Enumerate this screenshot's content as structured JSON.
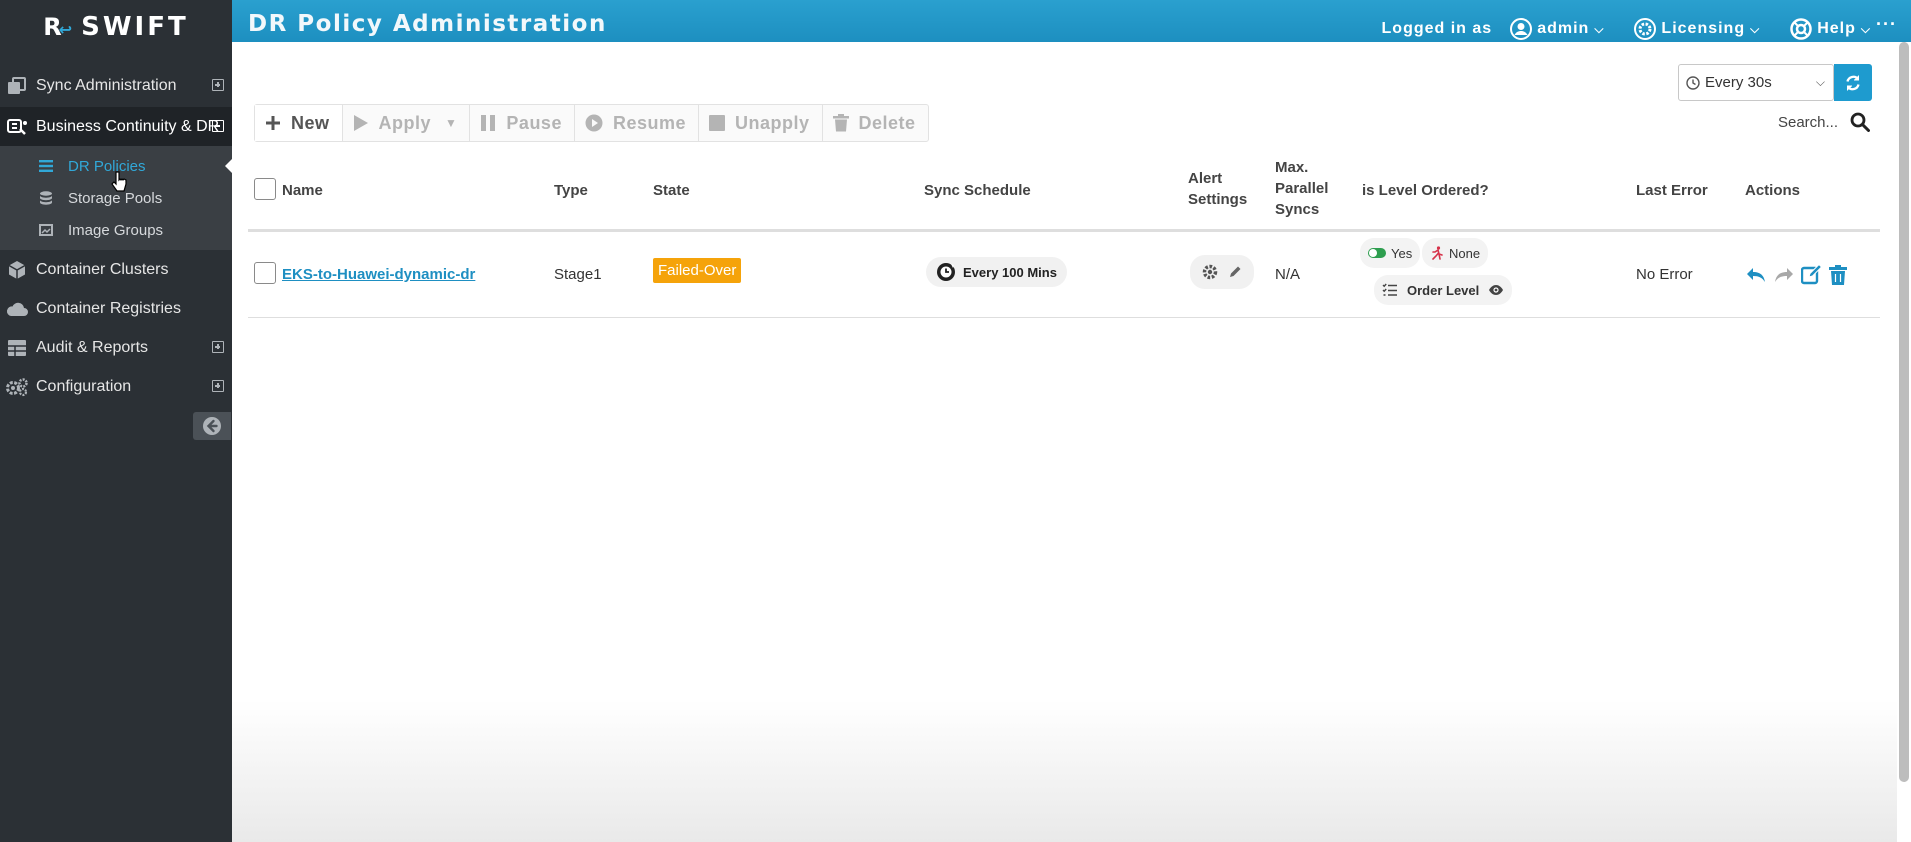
{
  "app": {
    "logo_mark": "R",
    "logo_accent": "↩",
    "logo_text": "SWIFT"
  },
  "sidebar": {
    "items": [
      {
        "label": "Sync Administration",
        "icon": "copy-icon",
        "expandable": "plus"
      },
      {
        "label": "Business Continuity & DR",
        "icon": "continuity-icon",
        "expandable": "minus",
        "active": true,
        "children": [
          {
            "label": "DR Policies",
            "icon": "list-icon",
            "selected": true
          },
          {
            "label": "Storage Pools",
            "icon": "database-icon"
          },
          {
            "label": "Image Groups",
            "icon": "image-icon"
          }
        ]
      },
      {
        "label": "Container Clusters",
        "icon": "cube-icon"
      },
      {
        "label": "Container Registries",
        "icon": "cloud-icon"
      },
      {
        "label": "Audit & Reports",
        "icon": "table-icon",
        "expandable": "plus"
      },
      {
        "label": "Configuration",
        "icon": "gears-icon",
        "expandable": "plus"
      }
    ]
  },
  "header": {
    "title": "DR Policy Administration",
    "logged_in_as": "Logged in as",
    "user": "admin",
    "licensing": "Licensing",
    "help": "Help",
    "more": "···"
  },
  "refresh": {
    "interval": "Every 30s",
    "search_placeholder": "Search..."
  },
  "toolbar": {
    "new": "New",
    "apply": "Apply",
    "pause": "Pause",
    "resume": "Resume",
    "unapply": "Unapply",
    "delete": "Delete"
  },
  "table": {
    "headers": {
      "name": "Name",
      "type": "Type",
      "state": "State",
      "sync_schedule": "Sync Schedule",
      "alert_settings_1": "Alert",
      "alert_settings_2": "Settings",
      "max_parallel_1": "Max.",
      "max_parallel_2": "Parallel",
      "max_parallel_3": "Syncs",
      "level_ordered": "is Level Ordered?",
      "last_error": "Last Error",
      "actions": "Actions"
    },
    "rows": [
      {
        "name": "EKS-to-Huawei-dynamic-dr",
        "type": "Stage1",
        "state": "Failed-Over",
        "sync_schedule": "Every 100 Mins",
        "max_parallel": "N/A",
        "level_ordered_toggle": "Yes",
        "level_ordered_mode": "None",
        "order_level": "Order Level",
        "last_error": "No Error"
      }
    ]
  },
  "colors": {
    "accent": "#1e9bcf",
    "sidebar_bg": "#2b3035",
    "state_failed_over": "#f5a30a",
    "toggle_on": "#2e9e4f"
  }
}
